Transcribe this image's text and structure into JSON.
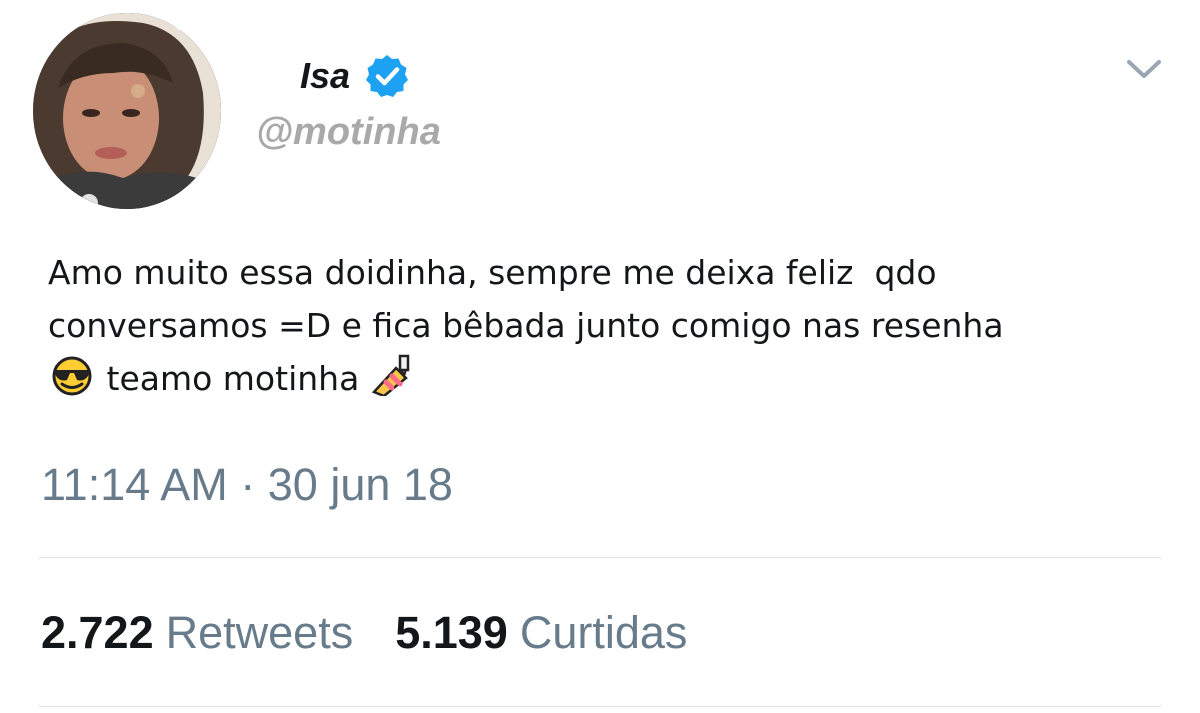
{
  "tweet": {
    "author": {
      "display_name": "Isa",
      "handle": "@motinha",
      "verified": true,
      "avatar": "profile-photo"
    },
    "text_lines": [
      "Amo muito essa doidinha, sempre me deixa feliz  qdo",
      "conversamos =D e fica bêbada junto comigo nas resenha",
      "teamo motinha"
    ],
    "emojis": [
      "smiling-face-with-sunglasses",
      "nail-polish"
    ],
    "timestamp": "11:14 AM · 30 jun 18",
    "stats": {
      "retweets_count": "2.722",
      "retweets_label": "Retweets",
      "likes_count": "5.139",
      "likes_label": "Curtidas"
    },
    "colors": {
      "text": "#14171a",
      "muted": "#687b8b",
      "handle": "#a9a9a9",
      "verified": "#1da1f2",
      "divider": "#dfe3e6"
    }
  }
}
